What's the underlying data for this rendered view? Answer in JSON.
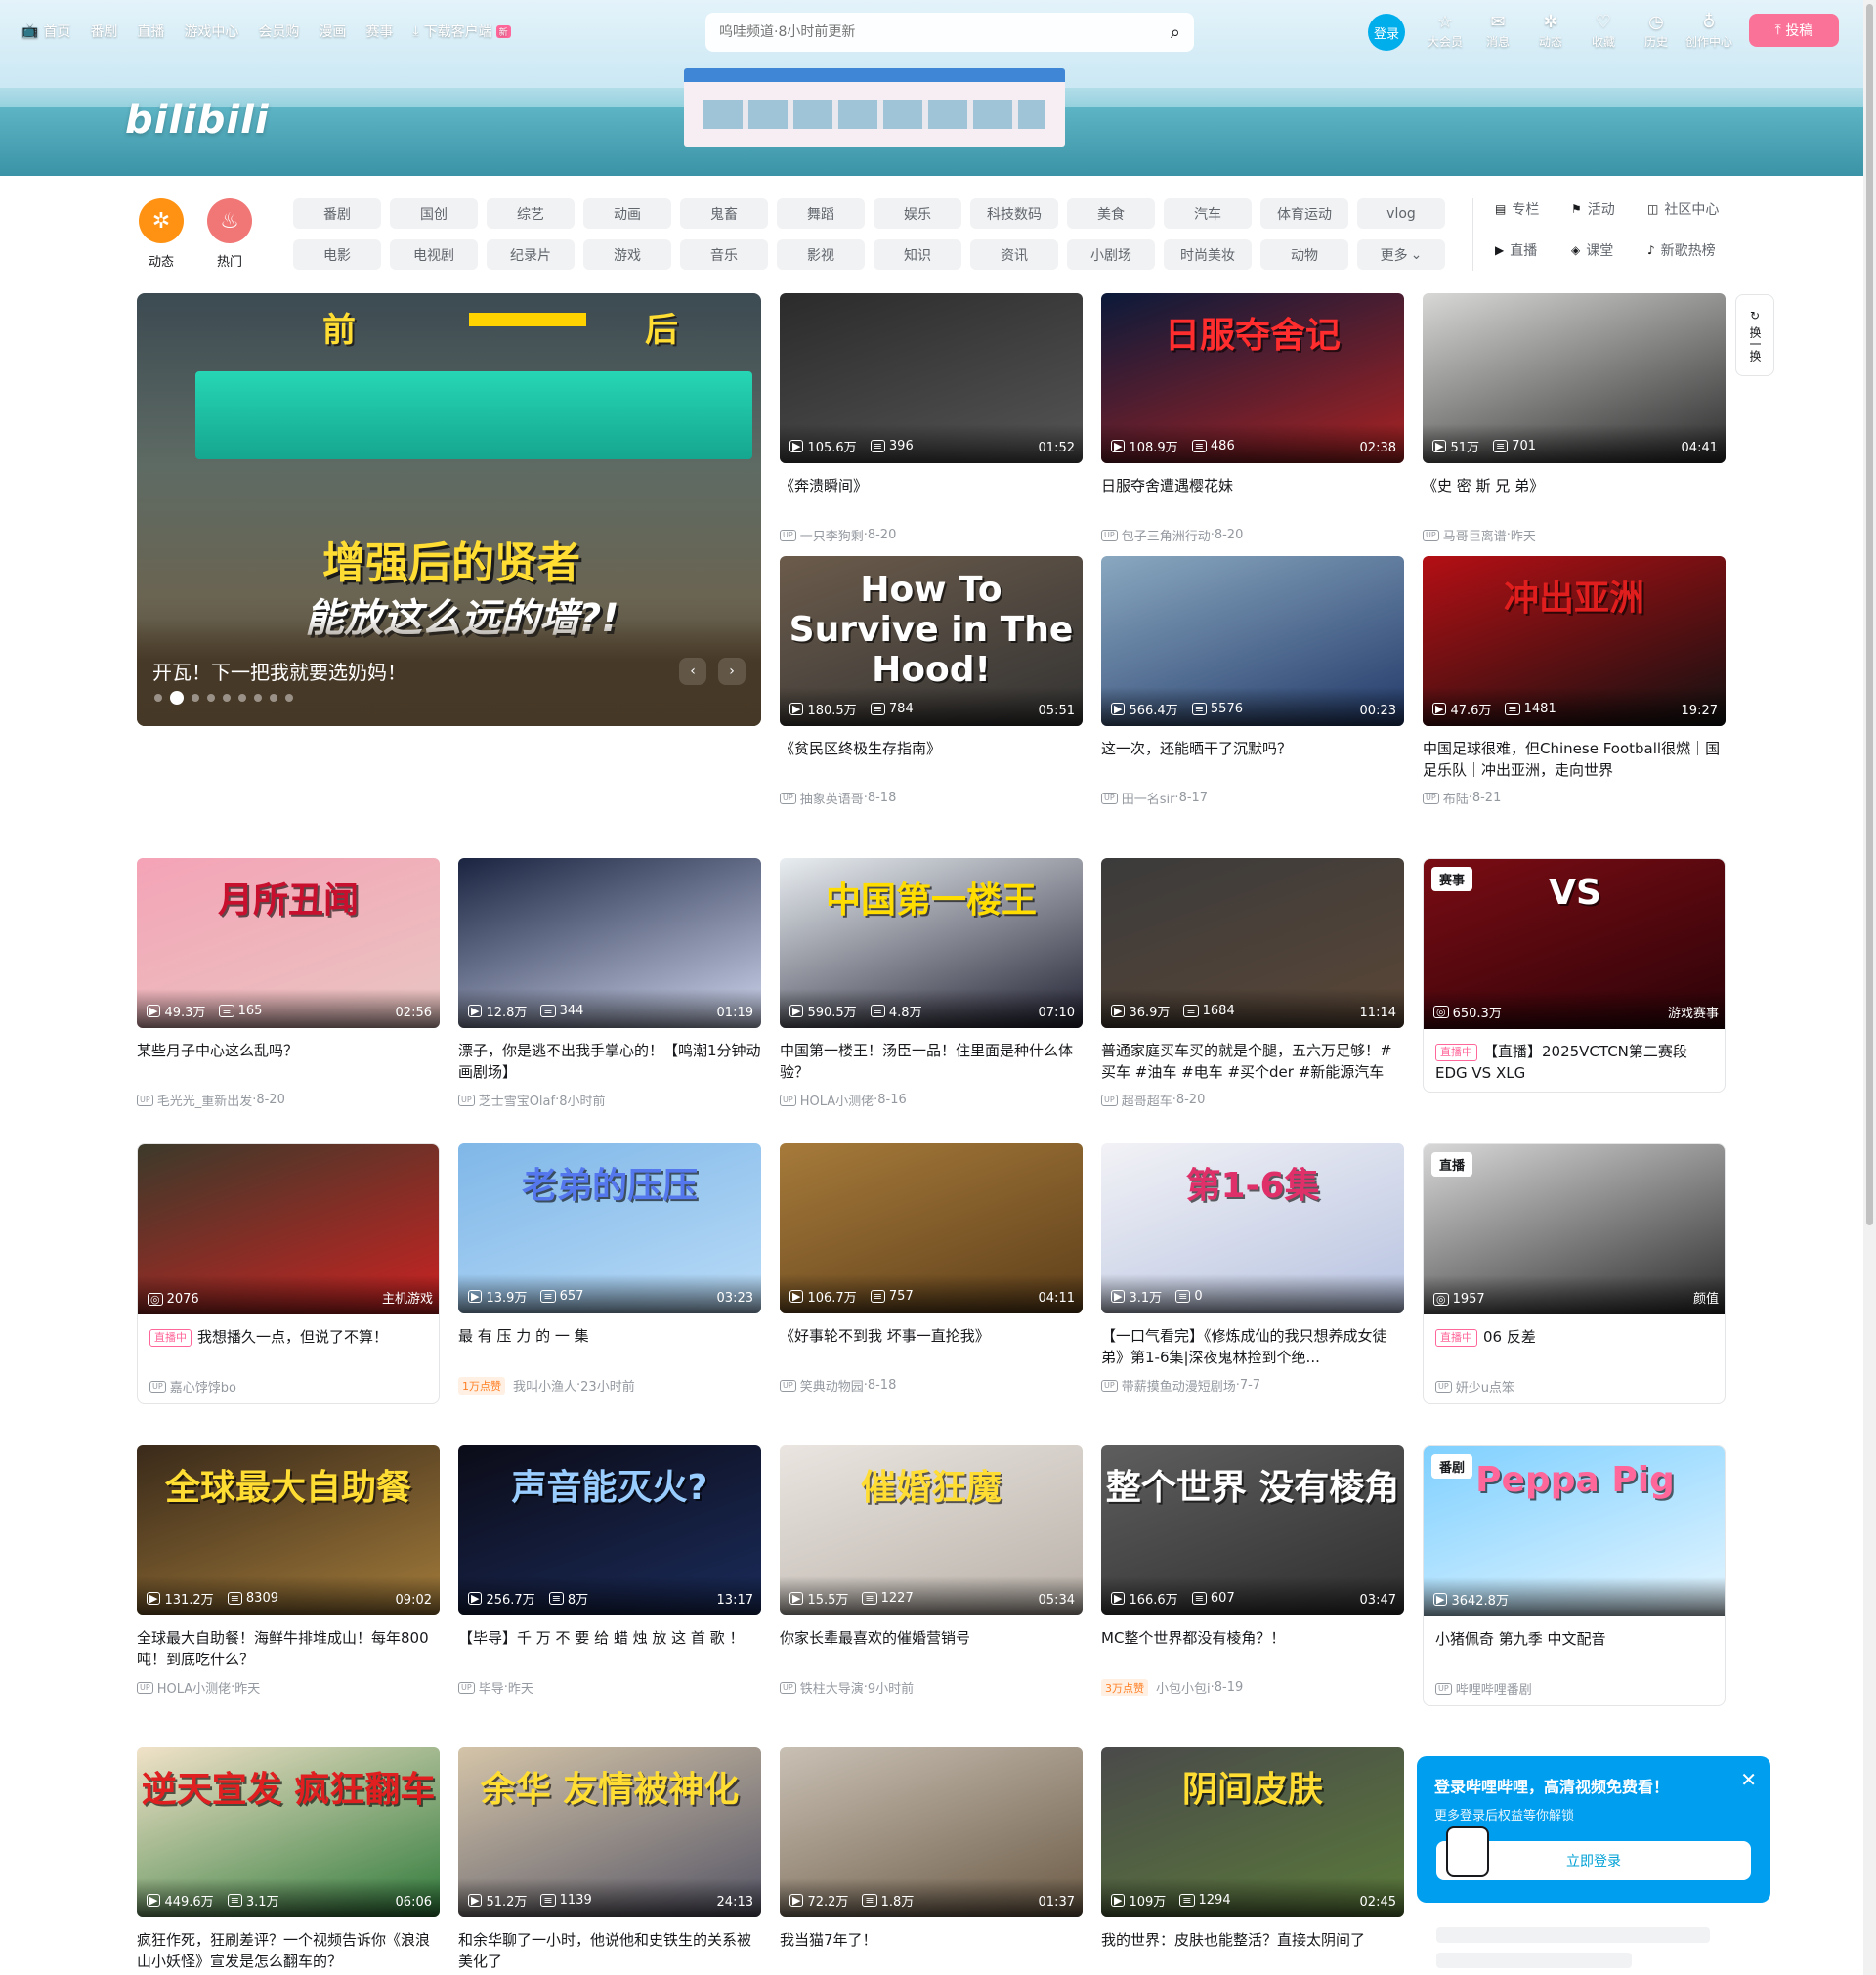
{
  "nav_left": [
    {
      "icon": "tv-icon",
      "label": "首页"
    },
    {
      "label": "番剧"
    },
    {
      "label": "直播"
    },
    {
      "label": "游戏中心"
    },
    {
      "label": "会员购"
    },
    {
      "label": "漫画"
    },
    {
      "label": "赛事"
    },
    {
      "icon": "download-icon",
      "label": "下载客户端",
      "badge": "新"
    }
  ],
  "search": {
    "placeholder": "呜哇频道·8小时前更新"
  },
  "nav_right": {
    "login": "登录",
    "items": [
      {
        "label": "大会员",
        "icon": "☆"
      },
      {
        "label": "消息",
        "icon": "✉"
      },
      {
        "label": "动态",
        "icon": "✲"
      },
      {
        "label": "收藏",
        "icon": "♡"
      },
      {
        "label": "历史",
        "icon": "◷"
      },
      {
        "label": "创作中心",
        "icon": "♁"
      }
    ],
    "upload": "投稿"
  },
  "banner_logo": "bilibili",
  "channels": {
    "big": [
      {
        "label": "动态",
        "color": "#ff9212",
        "icon": "✲"
      },
      {
        "label": "热门",
        "color": "#f07775",
        "icon": "♨"
      }
    ],
    "grid": [
      "番剧",
      "国创",
      "综艺",
      "动画",
      "鬼畜",
      "舞蹈",
      "娱乐",
      "科技数码",
      "美食",
      "汽车",
      "体育运动",
      "vlog",
      "电影",
      "电视剧",
      "纪录片",
      "游戏",
      "音乐",
      "影视",
      "知识",
      "资讯",
      "小剧场",
      "时尚美妆",
      "动物",
      "更多"
    ],
    "links": [
      {
        "icon": "▤",
        "label": "专栏"
      },
      {
        "icon": "⚑",
        "label": "活动"
      },
      {
        "icon": "◫",
        "label": "社区中心"
      },
      {
        "icon": "▶",
        "label": "直播"
      },
      {
        "icon": "◈",
        "label": "课堂"
      },
      {
        "icon": "♪",
        "label": "新歌热榜"
      }
    ]
  },
  "carousel": {
    "title": "开瓦！下一把我就要选奶妈！",
    "caption_before": "前",
    "caption_after": "后",
    "line1": "增强后的贤者",
    "line2": "能放这么远的墙?!",
    "dots": 9,
    "active": 1
  },
  "refresh": {
    "label": "换一换"
  },
  "cards": [
    {
      "views": "105.6万",
      "danmaku": "396",
      "duration": "01:52",
      "title": "《奔溃瞬间》",
      "author": "一只李狗剩",
      "date": "8-20"
    },
    {
      "views": "108.9万",
      "danmaku": "486",
      "duration": "02:38",
      "title": "日服夺舍遭遇樱花妹",
      "author": "包子三角洲行动",
      "date": "8-20",
      "overlay": "日服夺舍记"
    },
    {
      "views": "51万",
      "danmaku": "701",
      "duration": "04:41",
      "title": "《史 密 斯 兄 弟》",
      "author": "马哥巨离谱",
      "date": "昨天"
    },
    {
      "views": "180.5万",
      "danmaku": "784",
      "duration": "05:51",
      "title": "《贫民区终极生存指南》",
      "author": "抽象英语哥",
      "date": "8-18",
      "overlay": "How To Survive in The Hood!"
    },
    {
      "views": "566.4万",
      "danmaku": "5576",
      "duration": "00:23",
      "title": "这一次，还能晒干了沉默吗？",
      "author": "田一名sir",
      "date": "8-17"
    },
    {
      "views": "47.6万",
      "danmaku": "1481",
      "duration": "19:27",
      "title": "中国足球很难，但Chinese Football很燃｜国足乐队｜冲出亚洲，走向世界",
      "author": "布陆",
      "date": "8-21",
      "overlay": "冲出亚洲"
    },
    {
      "views": "49.3万",
      "danmaku": "165",
      "duration": "02:56",
      "title": "某些月子中心这么乱吗？",
      "author": "毛光光_重新出发",
      "date": "8-20",
      "overlay": "月所丑闻"
    },
    {
      "views": "12.8万",
      "danmaku": "344",
      "duration": "01:19",
      "title": "漂子，你是逃不出我手掌心的！【鸣潮1分钟动画剧场】",
      "author": "芝士雪宝Olaf",
      "date": "8小时前"
    },
    {
      "views": "590.5万",
      "danmaku": "4.8万",
      "duration": "07:10",
      "title": "中国第一楼王！汤臣一品！住里面是种什么体验？",
      "author": "HOLA小测佬",
      "date": "8-16",
      "overlay": "中国第一楼王"
    },
    {
      "views": "36.9万",
      "danmaku": "1684",
      "duration": "11:14",
      "title": "普通家庭买车买的就是个腿，五六万足够！#买车 #油车 #电车 #买个der #新能源汽车",
      "author": "超哥超车",
      "date": "8-20"
    },
    {
      "views": "650.3万",
      "tag": "赛事",
      "category": "游戏赛事",
      "live": "直播中",
      "title": "【直播】2025VCTCN第二赛段 EDG VS XLG",
      "overlay": "VS"
    },
    {
      "views": "2076",
      "category": "主机游戏",
      "live": "直播中",
      "title": "我想播久一点，但说了不算！",
      "author": "嘉心饽饽bo"
    },
    {
      "views": "13.9万",
      "danmaku": "657",
      "duration": "03:23",
      "title": "最 有 压 力 的 一 集",
      "hot": "1万点赞",
      "author": "我叫小渔人",
      "date": "23小时前",
      "overlay": "老弟的压压"
    },
    {
      "views": "106.7万",
      "danmaku": "757",
      "duration": "04:11",
      "title": "《好事轮不到我 坏事一直抡我》",
      "author": "笑典动物园",
      "date": "8-18"
    },
    {
      "views": "3.1万",
      "danmaku": "0",
      "duration": "",
      "title": "【一口气看完】《修炼成仙的我只想养成女徒弟》第1-6集|深夜鬼林捡到个绝...",
      "author": "带薪摸鱼动漫短剧场",
      "date": "7-7",
      "overlay": "第1-6集"
    },
    {
      "views": "1957",
      "tag": "直播",
      "category": "颜值",
      "live": "直播中",
      "title": "06 反差",
      "author": "妍少u点笨"
    },
    {
      "views": "131.2万",
      "danmaku": "8309",
      "duration": "09:02",
      "title": "全球最大自助餐！海鲜牛排堆成山！每年800吨！到底吃什么？",
      "author": "HOLA小测佬",
      "date": "昨天",
      "overlay": "全球最大自助餐"
    },
    {
      "views": "256.7万",
      "danmaku": "8万",
      "duration": "13:17",
      "title": "【毕导】千 万 不 要 给 蜡 烛 放 这 首 歌 ！",
      "author": "毕导",
      "date": "昨天",
      "overlay": "声音能灭火?"
    },
    {
      "views": "15.5万",
      "danmaku": "1227",
      "duration": "05:34",
      "title": "你家长辈最喜欢的催婚营销号",
      "author": "铁柱大导演",
      "date": "9小时前",
      "overlay": "催婚狂魔"
    },
    {
      "views": "166.6万",
      "danmaku": "607",
      "duration": "03:47",
      "title": "MC整个世界都没有棱角？！",
      "hot": "3万点赞",
      "author": "小包小包i",
      "date": "8-19",
      "overlay": "整个世界 没有棱角"
    },
    {
      "views": "3642.8万",
      "tag": "番剧",
      "title": "小猪佩奇 第九季 中文配音",
      "author": "哔哩哔哩番剧",
      "overlay": "Peppa Pig"
    },
    {
      "views": "449.6万",
      "danmaku": "3.1万",
      "duration": "06:06",
      "title": "疯狂作死，狂刷差评？一个视频告诉你《浪浪山小妖怪》宣发是怎么翻车的？",
      "overlay": "逆天宣发 疯狂翻车"
    },
    {
      "views": "51.2万",
      "danmaku": "1139",
      "duration": "24:13",
      "title": "和余华聊了一小时，他说他和史铁生的关系被美化了",
      "overlay": "余华 友情被神化"
    },
    {
      "views": "72.2万",
      "danmaku": "1.8万",
      "duration": "01:37",
      "title": "我当猫7年了！"
    },
    {
      "views": "109万",
      "danmaku": "1294",
      "duration": "02:45",
      "title": "我的世界：皮肤也能整活？直接太阴间了",
      "overlay": "阴间皮肤"
    }
  ],
  "popup": {
    "headline": "登录哔哩哔哩，高清视频免费看！",
    "sub": "更多登录后权益等你解锁",
    "button": "立即登录"
  },
  "colors": {
    "accent": "#00aeec",
    "pink": "#fb7299",
    "hot": "#ff7f24"
  }
}
